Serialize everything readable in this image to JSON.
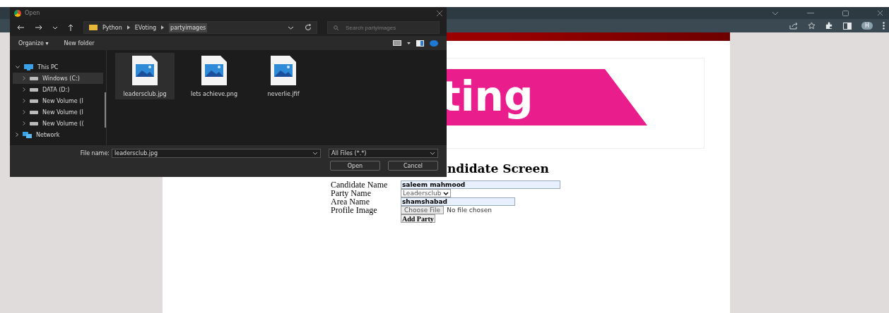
{
  "browser": {
    "profile_initial": "H"
  },
  "page": {
    "logo_text": "ting",
    "heading": "ndidate Screen",
    "form": {
      "fields": [
        {
          "kind": "text",
          "label": "Candidate Name",
          "value": "saleem mahmood"
        },
        {
          "kind": "select",
          "label": "Party Name",
          "value": "Leadersclub"
        },
        {
          "kind": "text",
          "label": "Area Name",
          "value": "shamshabad"
        },
        {
          "kind": "file",
          "label": "Profile Image",
          "button": "Choose File",
          "status": "No file chosen"
        }
      ],
      "submit": "Add Party"
    }
  },
  "dialog": {
    "title": "Open",
    "breadcrumb": [
      "Python",
      "EVoting",
      "partyimages"
    ],
    "search": {
      "placeholder": "Search partyimages"
    },
    "toolbar": [
      "Organize ▾",
      "New folder"
    ],
    "tree": [
      {
        "label": "This PC",
        "kind": "pc",
        "expanded": true,
        "selected": false,
        "children": [
          {
            "label": "Windows (C:)",
            "kind": "drive",
            "selected": true
          },
          {
            "label": "DATA (D:)",
            "kind": "drive",
            "selected": false
          },
          {
            "label": "New Volume (I",
            "kind": "drive",
            "selected": false
          },
          {
            "label": "New Volume (I",
            "kind": "drive",
            "selected": false
          },
          {
            "label": "New Volume ((",
            "kind": "drive",
            "selected": false
          }
        ]
      },
      {
        "label": "Network",
        "kind": "network",
        "expanded": false,
        "selected": false
      }
    ],
    "files": [
      {
        "name": "leadersclub.jpg",
        "selected": true
      },
      {
        "name": "lets achieve.png",
        "selected": false
      },
      {
        "name": "neverlie.jfif",
        "selected": false
      }
    ],
    "file_name_label": "File name:",
    "file_name": "leadersclub.jpg",
    "file_type": "All Files (*.*)",
    "buttons": [
      "Open",
      "Cancel"
    ]
  }
}
